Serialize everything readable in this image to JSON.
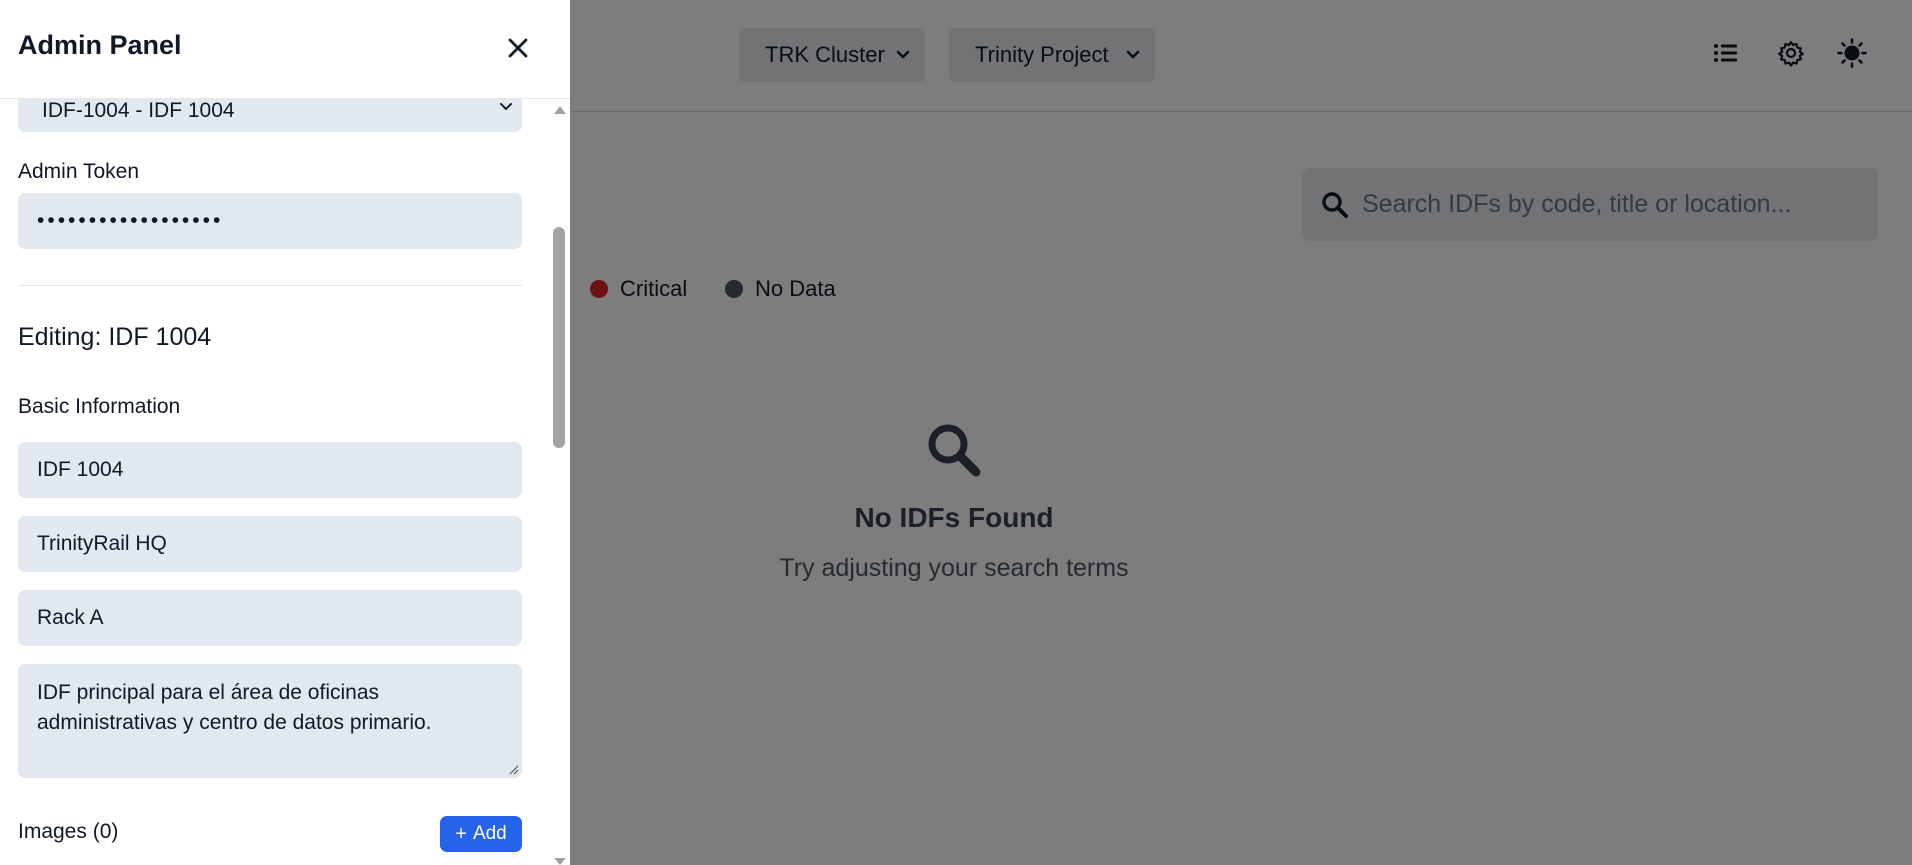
{
  "header": {
    "cluster_select": "TRK Cluster",
    "project_select": "Trinity Project",
    "icons": [
      "list-icon",
      "settings-icon",
      "theme-icon"
    ]
  },
  "search": {
    "placeholder": "Search IDFs by code, title or location..."
  },
  "legend": [
    {
      "label": "Critical",
      "color": "#dc2626"
    },
    {
      "label": "No Data",
      "color": "#4b5563"
    }
  ],
  "empty_state": {
    "title": "No IDFs Found",
    "message": "Try adjusting your search terms"
  },
  "admin_panel": {
    "title": "Admin Panel",
    "idf_select": "IDF-1004 - IDF 1004",
    "token_label": "Admin Token",
    "token_value": "••••••••••••••••••",
    "editing_heading": "Editing: IDF 1004",
    "basic_info_label": "Basic Information",
    "fields": {
      "title": "IDF 1004",
      "location": "TrinityRail HQ",
      "rack": "Rack A",
      "description": "IDF principal para el área de oficinas administrativas y centro de datos primario."
    },
    "images_label": "Images (0)",
    "add_button": "Add"
  },
  "colors": {
    "accent": "#2563eb",
    "field_bg": "#e2e8f0",
    "critical": "#dc2626",
    "no_data": "#4b5563"
  }
}
